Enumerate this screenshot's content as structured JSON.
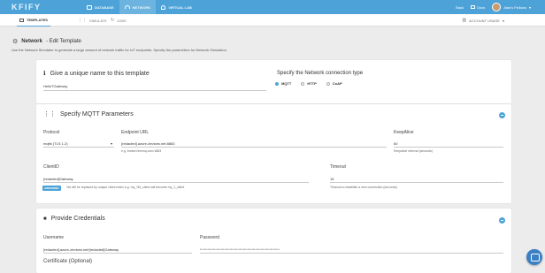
{
  "topbar": {
    "logo": "KFIFY",
    "nav": [
      {
        "label": "DATABASE",
        "icon": "database-icon"
      },
      {
        "label": "NETWORK",
        "icon": "wifi-icon",
        "active": true
      },
      {
        "label": "VIRTUAL LAB",
        "icon": "person-icon"
      }
    ],
    "right": {
      "back": "Back",
      "docs": "Docs",
      "user": "Alan's Fellowo"
    }
  },
  "subbar": {
    "tabs": [
      {
        "label": "TEMPLATES",
        "active": true
      },
      {
        "label": "SIMULATE"
      },
      {
        "label": "JOBS"
      }
    ],
    "account": "ACCOUNT USAGE"
  },
  "page": {
    "heading_bold": "Network",
    "heading_rest": "- Edit Template",
    "description": "Use the Network Simulator to generate a large amount of network traffic for IoT endpoints. Specify the parameters for Network Simulation."
  },
  "card_name": {
    "title": "Give a unique name to this template",
    "value": "HelloTGateway",
    "type_title": "Specify the Network connection type",
    "options": [
      "MQTT",
      "HTTP",
      "CoAP"
    ],
    "selected": "MQTT"
  },
  "card_mqtt": {
    "title": "Specify MQTT Parameters",
    "protocol_label": "Protocol",
    "protocol_value": "mqtts (TLS 1.2)",
    "endpoint_label": "Endpoint URL",
    "endpoint_value": "[redacted].azure-devices.net:8883",
    "endpoint_hint": "e.g. broker.hivemq.com:1883",
    "keepalive_label": "KeepAlive",
    "keepalive_value": "60",
    "keepalive_hint": "Keepalive interval (seconds)",
    "clientid_label": "ClientID",
    "clientid_value": "[redacted]Gateway",
    "badge": "AWESOME!",
    "clientid_hint": "%d will be replaced by unique client index e.g. my_%d_client will become my_1_client",
    "timeout_label": "Timeout",
    "timeout_value": "15",
    "timeout_hint": "Timeout to establish a new connection (seconds)"
  },
  "card_creds": {
    "title": "Provide Credentials",
    "username_label": "Username",
    "username_value": "[redacted].azure-devices.net/[redacted]Gateway",
    "password_label": "Password",
    "password_value": "••••••••••••••••••••••••••••••••••••••••••••••••••••••••••••••••••••••••",
    "cert_label": "Certificate (Optional)"
  }
}
